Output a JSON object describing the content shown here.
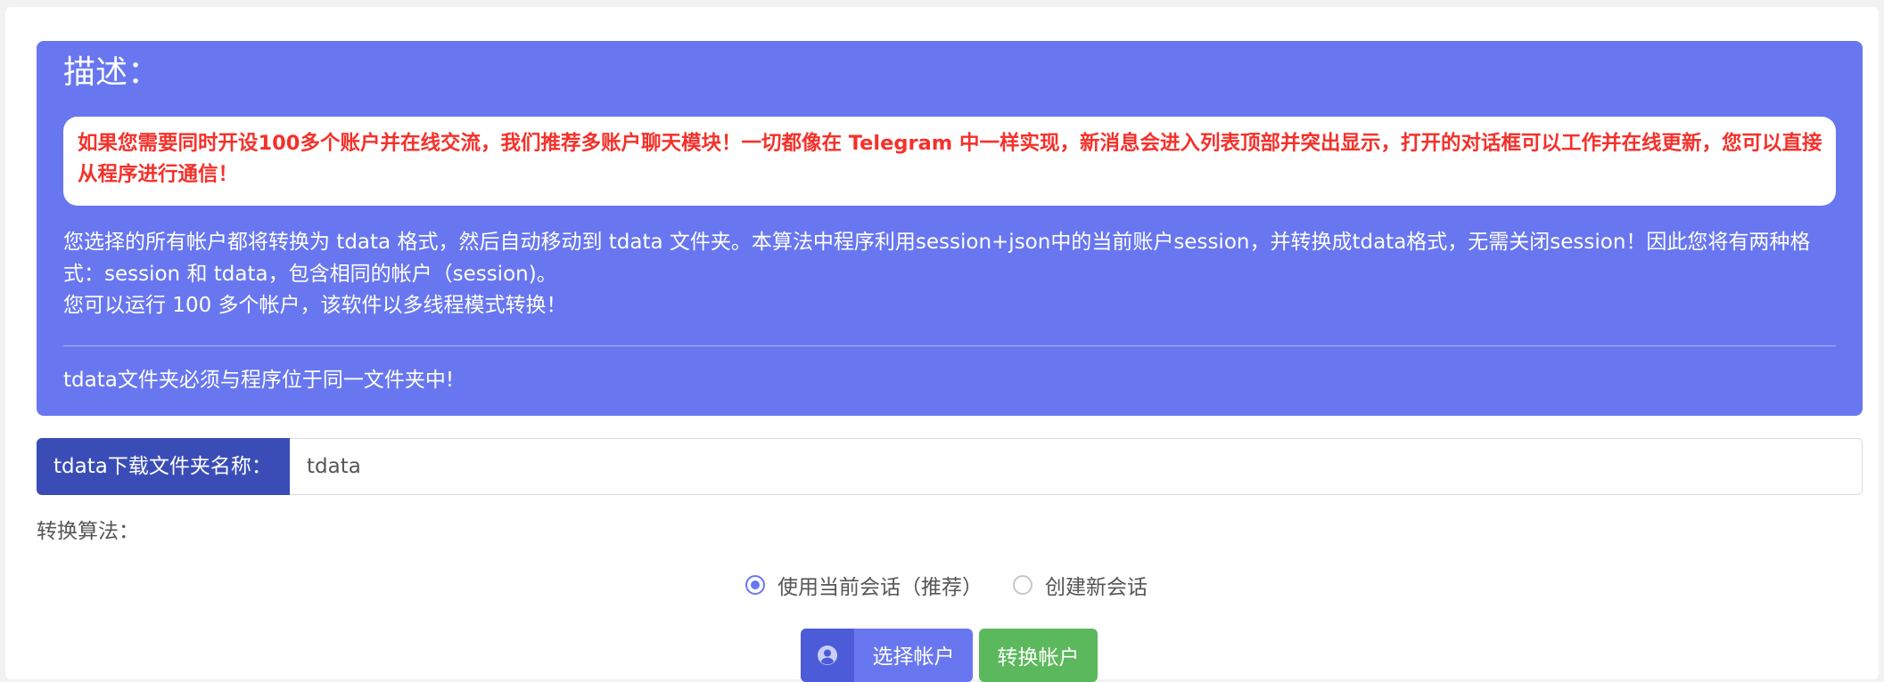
{
  "description": {
    "title": "描述：",
    "alert": "如果您需要同时开设100多个账户并在线交流，我们推荐多账户聊天模块！一切都像在 Telegram 中一样实现，新消息会进入列表顶部并突出显示，打开的对话框可以工作并在线更新，您可以直接从程序进行通信！",
    "body_line1": "您选择的所有帐户都将转换为 tdata 格式，然后自动移动到 tdata 文件夹。本算法中程序利用session+json中的当前账户session，并转换成tdata格式，无需关闭session！因此您将有两种格式：session 和 tdata，包含相同的帐户（session)。",
    "body_line2": "您可以运行 100 多个帐户，该软件以多线程模式转换！",
    "footer": "tdata文件夹必须与程序位于同一文件夹中!"
  },
  "folder": {
    "label": "tdata下载文件夹名称：",
    "value": "tdata"
  },
  "algorithm": {
    "label": "转换算法：",
    "options": [
      {
        "label": "使用当前会话（推荐）",
        "checked": true
      },
      {
        "label": "创建新会话",
        "checked": false
      }
    ]
  },
  "actions": {
    "select_label": "选择帐户",
    "select_icon": "user-circle-icon",
    "convert_label": "转换帐户"
  },
  "colors": {
    "accent": "#6877f0",
    "accent_dark": "#3a4db7",
    "alert_text": "#f4312a",
    "success": "#5cb85c"
  }
}
